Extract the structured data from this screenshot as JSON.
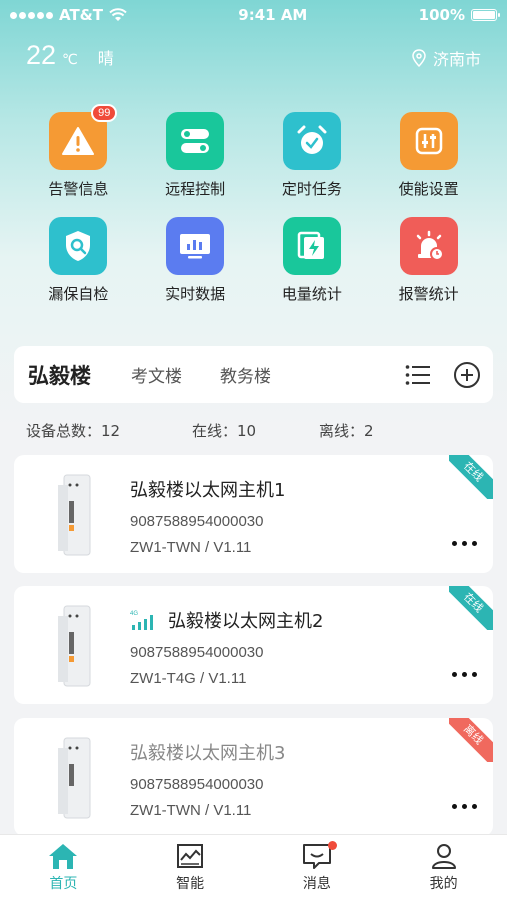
{
  "status_bar": {
    "carrier": "AT&T",
    "time": "9:41 AM",
    "battery": "100%"
  },
  "weather": {
    "temperature": "22",
    "unit": "℃",
    "condition": "晴",
    "location": "济南市"
  },
  "features": [
    {
      "label": "告警信息",
      "icon": "alert-icon",
      "color": "#f59a34",
      "badge": "99"
    },
    {
      "label": "远程控制",
      "icon": "toggle-icon",
      "color": "#19c79b"
    },
    {
      "label": "定时任务",
      "icon": "alarm-clock-icon",
      "color": "#2ec0cd"
    },
    {
      "label": "使能设置",
      "icon": "settings-sliders-icon",
      "color": "#f59a34"
    },
    {
      "label": "漏保自检",
      "icon": "shield-search-icon",
      "color": "#2ec0cd"
    },
    {
      "label": "实时数据",
      "icon": "monitor-chart-icon",
      "color": "#5b7cf0"
    },
    {
      "label": "电量统计",
      "icon": "lightning-doc-icon",
      "color": "#19c79b"
    },
    {
      "label": "报警统计",
      "icon": "siren-icon",
      "color": "#f05d58"
    }
  ],
  "buildings": {
    "active": "弘毅楼",
    "others": [
      "考文楼",
      "教务楼"
    ]
  },
  "stats": {
    "total": "设备总数：12",
    "online": "在线：10",
    "offline": "离线：2"
  },
  "devices": [
    {
      "name": "弘毅楼以太网主机1",
      "id": "9087588954000030",
      "model": "ZW1-TWN / V1.11",
      "status": "在线",
      "status_color": "#2cb5b3",
      "signal": false
    },
    {
      "name": "弘毅楼以太网主机2",
      "id": "9087588954000030",
      "model": "ZW1-T4G / V1.11",
      "status": "在线",
      "status_color": "#2cb5b3",
      "signal": true,
      "signal_label": "4G"
    },
    {
      "name": "弘毅楼以太网主机3",
      "id": "9087588954000030",
      "model": "ZW1-TWN / V1.11",
      "status": "离线",
      "status_color": "#f0695e",
      "signal": false
    }
  ],
  "tabbar": [
    {
      "label": "首页",
      "icon": "home-icon",
      "active": true
    },
    {
      "label": "智能",
      "icon": "chart-frame-icon"
    },
    {
      "label": "消息",
      "icon": "message-icon",
      "dot": true
    },
    {
      "label": "我的",
      "icon": "person-icon"
    }
  ]
}
